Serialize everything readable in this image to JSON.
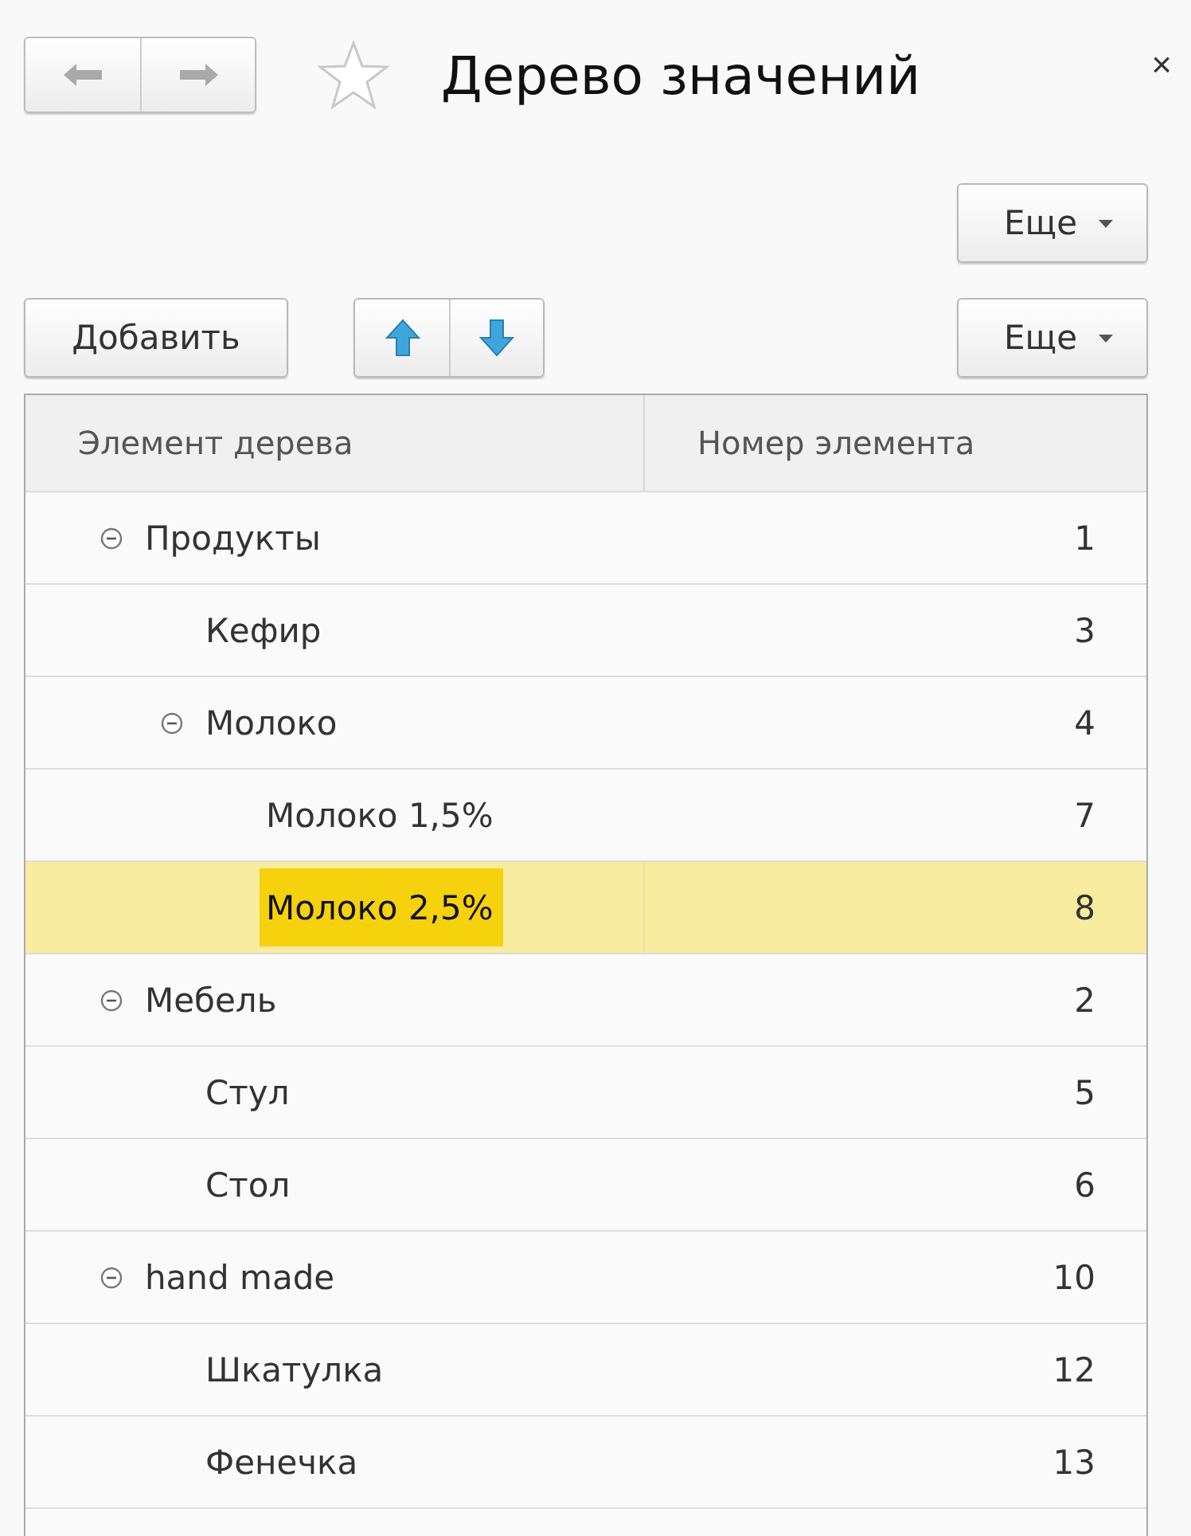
{
  "window": {
    "title": "Дерево значений",
    "close": "×"
  },
  "command_bar": {
    "more_button": "Еще"
  },
  "toolbar": {
    "add_button": "Добавить",
    "more_button": "Еще"
  },
  "table": {
    "columns": [
      "Элемент дерева",
      "Номер элемента"
    ],
    "rows": [
      {
        "name": "Продукты",
        "number": "1",
        "expanded": true,
        "selected": false,
        "children": [
          {
            "name": "Кефир",
            "number": "3",
            "selected": false
          },
          {
            "name": "Молоко",
            "number": "4",
            "expanded": true,
            "selected": false,
            "children": [
              {
                "name": "Молоко 1,5%",
                "number": "7",
                "selected": false
              },
              {
                "name": "Молоко 2,5%",
                "number": "8",
                "selected": true
              }
            ]
          }
        ]
      },
      {
        "name": "Мебель",
        "number": "2",
        "expanded": true,
        "selected": false,
        "children": [
          {
            "name": "Стул",
            "number": "5",
            "selected": false
          },
          {
            "name": "Стол",
            "number": "6",
            "selected": false
          }
        ]
      },
      {
        "name": "hand made",
        "number": "10",
        "expanded": true,
        "selected": false,
        "children": [
          {
            "name": "Шкатулка",
            "number": "12",
            "selected": false
          },
          {
            "name": "Фенечка",
            "number": "13",
            "selected": false
          }
        ]
      }
    ]
  }
}
